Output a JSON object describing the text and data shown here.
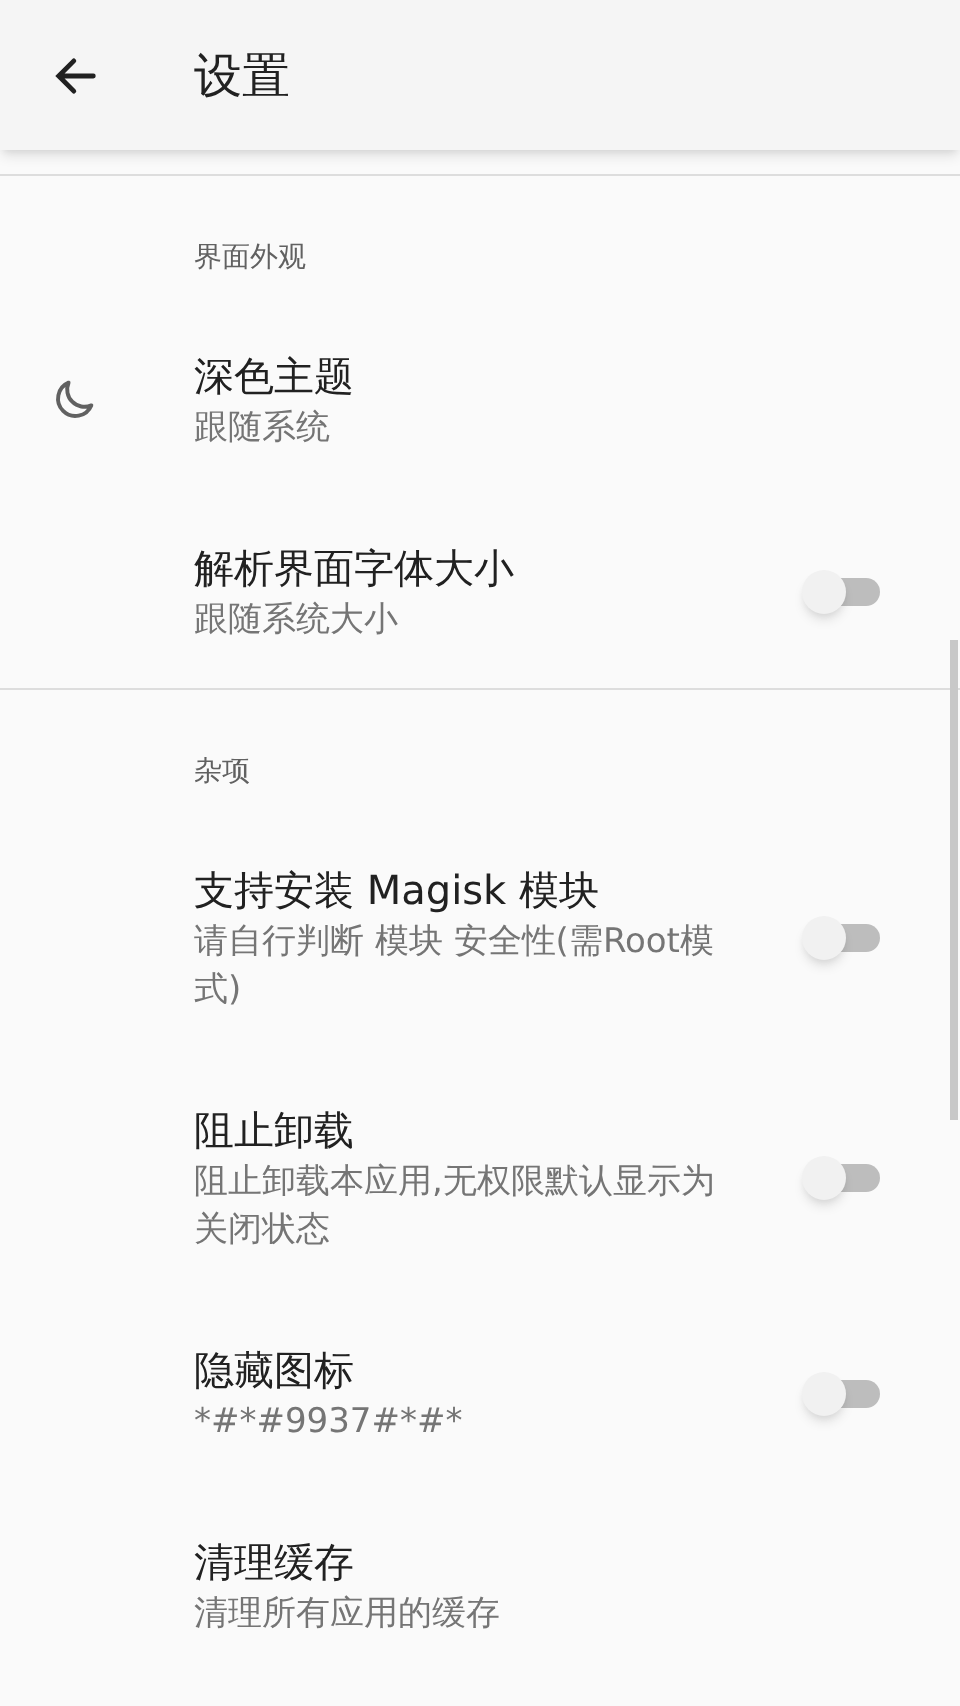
{
  "toolbar": {
    "title": "设置"
  },
  "sections": [
    {
      "header": "界面外观",
      "items": [
        {
          "kind": "icon",
          "title": "深色主题",
          "summary": "跟随系统"
        },
        {
          "kind": "switch",
          "title": "解析界面字体大小",
          "summary": "跟随系统大小",
          "on": false
        }
      ]
    },
    {
      "header": "杂项",
      "items": [
        {
          "kind": "switch",
          "title": "支持安装 Magisk 模块",
          "summary": "请自行判断 模块 安全性(需Root模式)",
          "on": false
        },
        {
          "kind": "switch",
          "title": "阻止卸载",
          "summary": "阻止卸载本应用,无权限默认显示为关闭状态",
          "on": false
        },
        {
          "kind": "switch",
          "title": "隐藏图标",
          "summary": "*#*#9937#*#*",
          "on": false
        },
        {
          "kind": "plain",
          "title": "清理缓存",
          "summary": "清理所有应用的缓存"
        }
      ]
    }
  ]
}
